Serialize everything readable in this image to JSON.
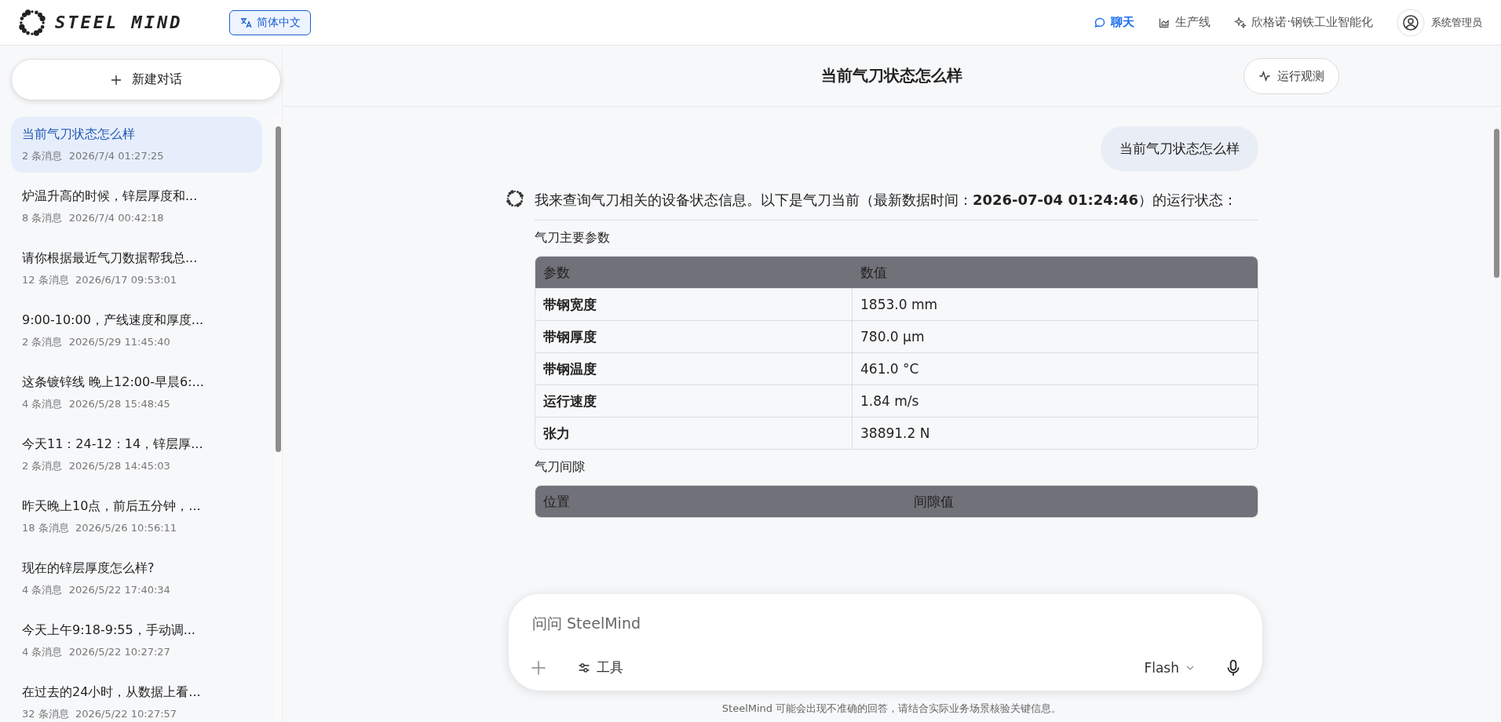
{
  "header": {
    "logo_text": "STEEL MIND",
    "language_button": "简体中文",
    "nav": [
      {
        "label": "聊天",
        "selected": true
      },
      {
        "label": "生产线",
        "selected": false
      },
      {
        "label": "欣格诺·钢铁工业智能化",
        "selected": false
      }
    ],
    "user": "系统管理员"
  },
  "sidebar": {
    "new_chat_button": "新建对话",
    "conversations": [
      {
        "title": "当前气刀状态怎么样",
        "count": "2 条消息",
        "time": "2026/7/4 01:27:25",
        "selected": true
      },
      {
        "title": "炉温升高的时候，锌层厚度和...",
        "count": "8 条消息",
        "time": "2026/7/4 00:42:18",
        "selected": false
      },
      {
        "title": "请你根据最近气刀数据帮我总...",
        "count": "12 条消息",
        "time": "2026/6/17 09:53:01",
        "selected": false
      },
      {
        "title": "9:00-10:00，产线速度和厚度...",
        "count": "2 条消息",
        "time": "2026/5/29 11:45:40",
        "selected": false
      },
      {
        "title": "这条镀锌线 晚上12:00-早晨6:...",
        "count": "4 条消息",
        "time": "2026/5/28 15:48:45",
        "selected": false
      },
      {
        "title": "今天11：24-12：14，锌层厚...",
        "count": "2 条消息",
        "time": "2026/5/28 14:45:03",
        "selected": false
      },
      {
        "title": "昨天晚上10点，前后五分钟，...",
        "count": "18 条消息",
        "time": "2026/5/26 10:56:11",
        "selected": false
      },
      {
        "title": "现在的锌层厚度怎么样?",
        "count": "4 条消息",
        "time": "2026/5/22 17:40:34",
        "selected": false
      },
      {
        "title": "今天上午9:18-9:55，手动调...",
        "count": "4 条消息",
        "time": "2026/5/22 10:27:27",
        "selected": false
      },
      {
        "title": "在过去的24小时，从数据上看...",
        "count": "32 条消息",
        "time": "2026/5/22 10:27:57",
        "selected": false
      }
    ]
  },
  "chat": {
    "title": "当前气刀状态怎么样",
    "observe_button": "运行观测",
    "user_message": "当前气刀状态怎么样",
    "reply": {
      "intro": "我来查询气刀相关的设备状态信息。以下是气刀当前（最新数据时间：**2026-07-04 01:24:46**）的运行状态：",
      "sections": [
        {
          "title": "气刀主要参数",
          "columns": [
            "参数",
            "数值"
          ],
          "rows": [
            [
              "带钢宽度",
              "1853.0 mm"
            ],
            [
              "带钢厚度",
              "780.0 µm"
            ],
            [
              "带钢温度",
              "461.0 °C"
            ],
            [
              "运行速度",
              "1.84 m/s"
            ],
            [
              "张力",
              "38891.2 N"
            ]
          ]
        },
        {
          "title": "气刀间隙",
          "columns": [
            "位置",
            "间隙值"
          ]
        }
      ]
    }
  },
  "composer": {
    "placeholder": "问问 SteelMind",
    "tools_button": "工具",
    "model": "Flash"
  },
  "footer_note": "SteelMind 可能会出现不准确的回答，请结合实际业务场景核验关键信息。"
}
